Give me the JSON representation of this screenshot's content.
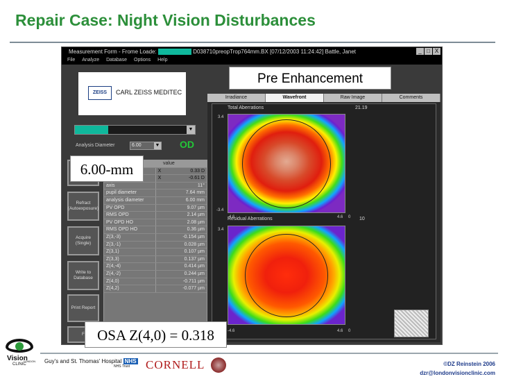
{
  "slide": {
    "title": "Repair Case: Night Vision Disturbances"
  },
  "window": {
    "title_prefix": "Measurement Form - Frome Loade:",
    "title_suffix": "D038710preopTrop764mm.BX [07/12/2003 11:24:42] Battle, Janet",
    "controls": [
      "_",
      "□",
      "X"
    ],
    "menu": [
      "File",
      "Analyze",
      "Database",
      "Options",
      "Help"
    ]
  },
  "brand": {
    "logo_text": "ZEISS",
    "company_text": "CARL ZEISS MEDITEC"
  },
  "analysis": {
    "diameter_label": "Analysis Diameter",
    "diameter_value": "6.00",
    "eye": "OD"
  },
  "side_buttons": [
    {
      "label": ""
    },
    {
      "label": "Refract (Autoexposure)"
    },
    {
      "label": "Acquire (Single)"
    },
    {
      "label": "Write to Database"
    },
    {
      "label": "Print Report"
    },
    {
      "label": "F"
    }
  ],
  "table": {
    "header": "value",
    "rows": [
      {
        "name": "sphere",
        "x": "X",
        "value": "0.33 D"
      },
      {
        "name": "cylinder",
        "x": "X",
        "value": "-0.61 D"
      },
      {
        "name": "axis",
        "x": "",
        "value": "11°"
      },
      {
        "name": "pupil diameter",
        "x": "",
        "value": "7.64 mm"
      },
      {
        "name": "analysis diameter",
        "x": "",
        "value": "6.00 mm"
      },
      {
        "name": "PV OPD",
        "x": "",
        "value": "9.07 µm"
      },
      {
        "name": "RMS OPD",
        "x": "",
        "value": "2.14 µm"
      },
      {
        "name": "PV OPD HO",
        "x": "",
        "value": "2.08 µm"
      },
      {
        "name": "RMS OPD HO",
        "x": "",
        "value": "0.36 µm"
      },
      {
        "name": "Z(3,-3)",
        "x": "",
        "value": "-0.154 µm"
      },
      {
        "name": "Z(3,-1)",
        "x": "",
        "value": "0.028 µm"
      },
      {
        "name": "Z(3,1)",
        "x": "",
        "value": "0.107 µm"
      },
      {
        "name": "Z(3,3)",
        "x": "",
        "value": "0.137 µm"
      },
      {
        "name": "Z(4,-4)",
        "x": "",
        "value": "0.414 µm"
      },
      {
        "name": "Z(4,-2)",
        "x": "",
        "value": "0.244 µm"
      },
      {
        "name": "Z(4,0)",
        "x": "",
        "value": "-0.711 µm"
      },
      {
        "name": "Z(4,2)",
        "x": "",
        "value": "-0.077 µm"
      }
    ]
  },
  "tabs": [
    {
      "label": "Irradiance",
      "active": false
    },
    {
      "label": "Wavefront",
      "active": true
    },
    {
      "label": "Raw Image",
      "active": false
    },
    {
      "label": "Comments",
      "active": false
    }
  ],
  "plots": {
    "top_label": "Total Aberrations",
    "top_max": "21.19",
    "top_y_top": "3.4",
    "top_y_bottom": "-3.4",
    "top_x_left": "-4.6",
    "top_x_right": "4.6",
    "top_x_zero": "0",
    "bottom_label": "Residual Aberrations",
    "bottom_max": "10",
    "bottom_y_top": "3.4",
    "bottom_x_left": "-4.6",
    "bottom_x_right": "4.6",
    "bottom_x_zero": "0"
  },
  "callouts": {
    "pre": "Pre Enhancement",
    "mm": "6.00-mm",
    "osa": "OSA Z(4,0) = 0.318"
  },
  "footer": {
    "vision_text": "Vision",
    "clinic_text": "CLINIC",
    "london_text": "LONDON",
    "guys_text": "Guy's and St. Thomas' Hospital",
    "nhs_text": "NHS",
    "nhs_trust": "NHS Trust",
    "cornell_text": "CORNELL",
    "credit_line1": "©DZ Reinstein 2006",
    "credit_line2": "dzr@londonvisionclinic.com"
  }
}
